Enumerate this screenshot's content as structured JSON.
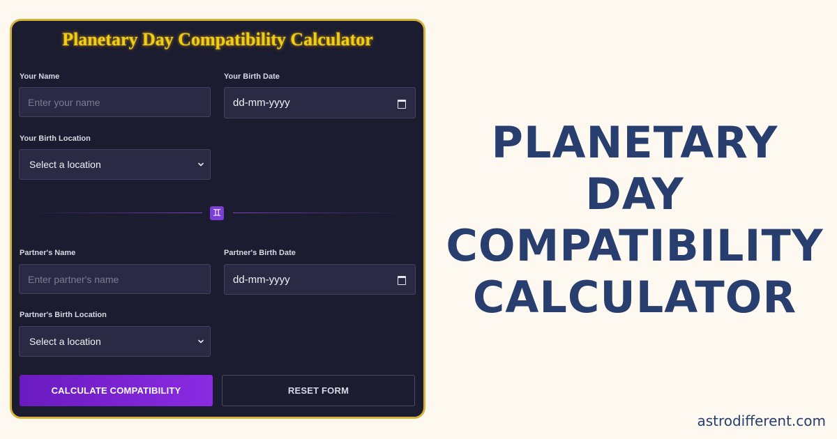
{
  "form": {
    "title": "Planetary Day Compatibility Calculator",
    "your_name_label": "Your Name",
    "your_name_placeholder": "Enter your name",
    "your_birth_date_label": "Your Birth Date",
    "your_birth_date_value": "dd-mm-yyyy",
    "your_birth_location_label": "Your Birth Location",
    "your_birth_location_value": "Select a location",
    "divider_symbol": "♊",
    "partner_name_label": "Partner's Name",
    "partner_name_placeholder": "Enter partner's name",
    "partner_birth_date_label": "Partner's Birth Date",
    "partner_birth_date_value": "dd-mm-yyyy",
    "partner_birth_location_label": "Partner's Birth Location",
    "partner_birth_location_value": "Select a location",
    "calculate_button": "CALCULATE COMPATIBILITY",
    "reset_button": "RESET FORM"
  },
  "headline": {
    "line1": "PLANETARY",
    "line2": "DAY",
    "line3": "COMPATIBILITY",
    "line4": "CALCULATOR"
  },
  "site": "astrodifferent.com",
  "colors": {
    "card_bg": "#1c1c30",
    "card_border": "#d7b23c",
    "title": "#f5cc14",
    "accent": "#8a2be2",
    "headline": "#283e6e",
    "page_bg": "#fdf9f1"
  },
  "icons": {
    "date": "calendar-icon",
    "select": "chevron-down-icon",
    "divider": "gemini-icon"
  }
}
